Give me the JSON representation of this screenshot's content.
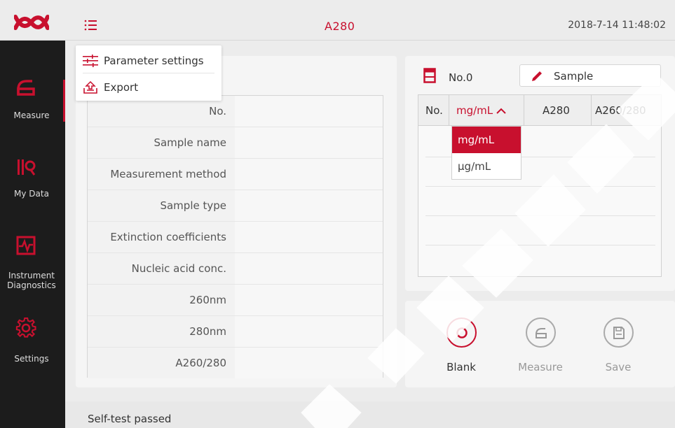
{
  "header": {
    "title": "A280",
    "datetime": "2018-7-14  11:48:02"
  },
  "icons": {
    "logo": "brand-logo-icon",
    "menu": "menu-list-icon"
  },
  "colors": {
    "accent": "#c8102e",
    "sidebar_bg": "#1c1c1c"
  },
  "sidebar": {
    "items": [
      {
        "label": "Measure",
        "icon": "measure-icon",
        "active": true
      },
      {
        "label": "My Data",
        "icon": "my-data-icon",
        "active": false
      },
      {
        "label": "Instrument Diagnostics",
        "label_line1": "Instrument",
        "label_line2": "Diagnostics",
        "icon": "diagnostics-icon",
        "active": false
      },
      {
        "label": "Settings",
        "icon": "gear-icon",
        "active": false
      }
    ]
  },
  "menu": {
    "items": [
      {
        "label": "Parameter settings",
        "icon": "sliders-icon"
      },
      {
        "label": "Export",
        "icon": "export-icon"
      }
    ]
  },
  "info_table": {
    "rows": [
      {
        "label": "No.",
        "value": ""
      },
      {
        "label": "Sample name",
        "value": ""
      },
      {
        "label": "Measurement method",
        "value": ""
      },
      {
        "label": "Sample type",
        "value": ""
      },
      {
        "label": "Extinction coefficients",
        "value": ""
      },
      {
        "label": "Nucleic acid conc.",
        "value": ""
      },
      {
        "label": "260nm",
        "value": ""
      },
      {
        "label": "280nm",
        "value": ""
      },
      {
        "label": "A260/280",
        "value": ""
      }
    ]
  },
  "results": {
    "number_label": "No.0",
    "sample_button_label": "Sample",
    "columns": [
      "No.",
      "mg/mL",
      "A280",
      "A260/280"
    ],
    "unit_options": [
      "mg/mL",
      "µg/mL"
    ],
    "selected_unit": "mg/mL"
  },
  "actions": [
    {
      "label": "Blank",
      "icon": "blank-circle-icon",
      "enabled": true
    },
    {
      "label": "Measure",
      "icon": "measure-icon",
      "enabled": false
    },
    {
      "label": "Save",
      "icon": "save-icon",
      "enabled": false
    }
  ],
  "status": {
    "text": "Self-test passed"
  }
}
